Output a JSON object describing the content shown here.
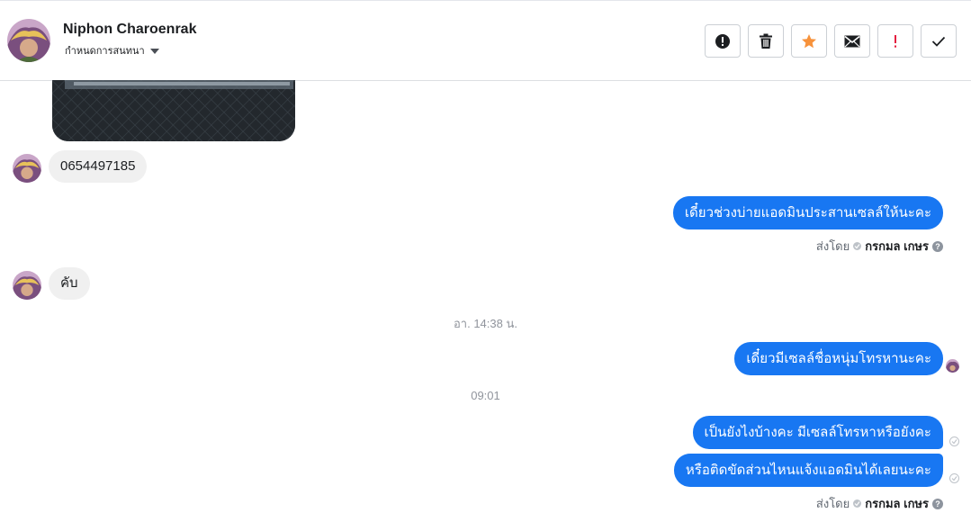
{
  "header": {
    "name": "Niphon Charoenrak",
    "subtitle": "กำหนดการสนทนา",
    "actions": [
      {
        "icon": "alert-circle-icon",
        "label": "mark-spam"
      },
      {
        "icon": "trash-icon",
        "label": "delete"
      },
      {
        "icon": "star-icon",
        "label": "star",
        "color": "#f7923b"
      },
      {
        "icon": "envelope-icon",
        "label": "mark-unread"
      },
      {
        "icon": "exclamation-icon",
        "label": "follow-up",
        "color": "#e41e3f"
      },
      {
        "icon": "check-icon",
        "label": "done"
      }
    ]
  },
  "messages": {
    "m1": "0654497185",
    "m2": "เดี๋ยวช่วงบ่ายแอดมินประสานเซลล์ให้นะคะ",
    "m3": "คับ",
    "m4": "เดี๋ยวมีเซลล์ชื่อหนุ่มโทรหานะคะ",
    "m5": "เป็นยังไงบ้างคะ มีเซลล์โทรหาหรือยังคะ",
    "m6": "หรือติดขัดส่วนไหนแจ้งแอดมินได้เลยนะคะ"
  },
  "sent_by": {
    "prefix": "ส่งโดย",
    "name": "กรกมล เกษร"
  },
  "time_separators": {
    "t1": "อา. 14:38 น.",
    "t2": "09:01"
  },
  "colors": {
    "outgoing_bubble": "#1877f2",
    "incoming_bubble": "#f0f0f0"
  }
}
